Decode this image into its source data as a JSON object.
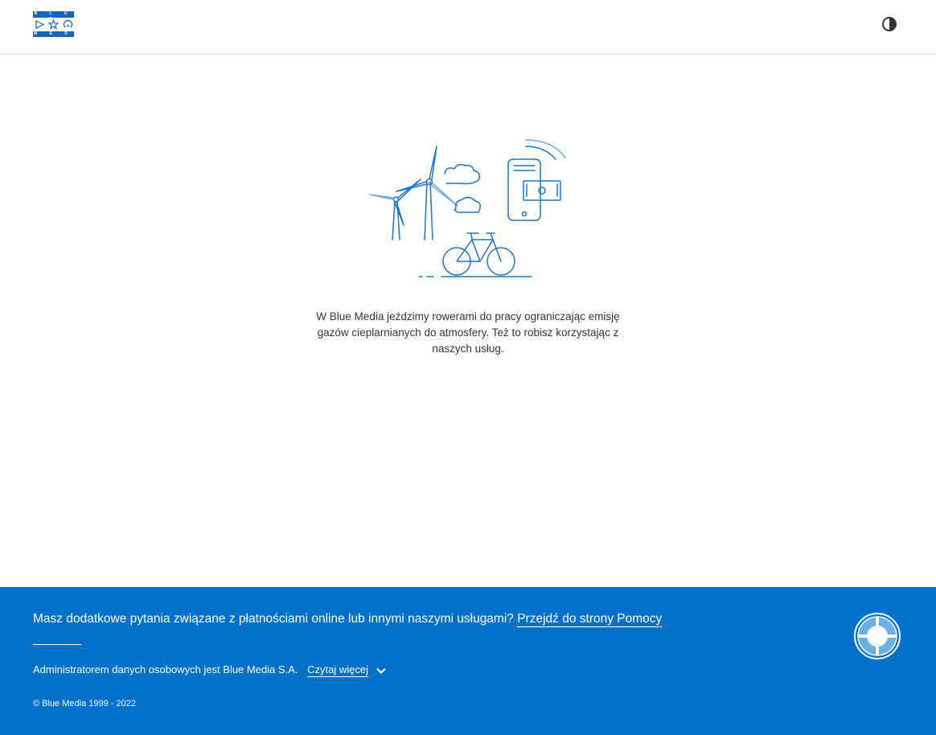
{
  "header": {
    "logo": {
      "top": "B L U E",
      "bottom": "M E D I A"
    },
    "contrast_icon": "contrast-icon"
  },
  "main": {
    "illustration_icon": "wind-turbines-bike-phone-illustration",
    "message": "W Blue Media jeździmy rowerami do pracy ograniczając emisję gazów cieplarnianych do atmosfery. Też to robisz korzystając z naszych usług."
  },
  "footer": {
    "help_question": "Masz dodatkowe pytania związane z płatnościami online lub innymi naszymi usługami?",
    "help_link": "Przejdź do strony Pomocy",
    "admin_text": "Administratorem danych osobowych jest Blue Media S.A.",
    "read_more": "Czytaj więcej",
    "copyright": "© Blue Media 1999 - 2022",
    "help_icon": "lifebuoy-icon"
  },
  "colors": {
    "brand": "#1565c0",
    "footer_bg": "#0070c9",
    "illustration": "#1e74c4"
  }
}
